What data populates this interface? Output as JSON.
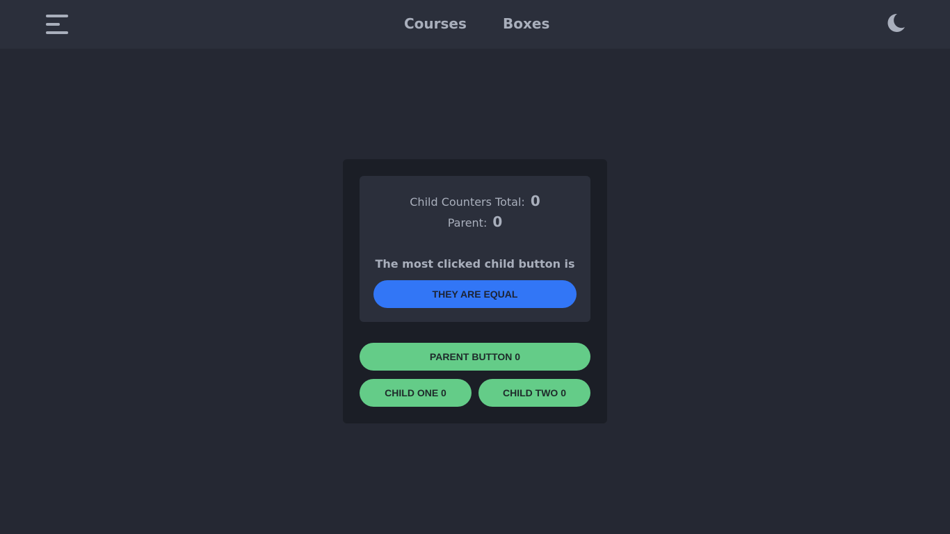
{
  "header": {
    "nav": [
      {
        "label": "Courses"
      },
      {
        "label": "Boxes"
      }
    ],
    "icons": {
      "menu": "hamburger-menu-icon",
      "theme": "moon-icon"
    }
  },
  "counter_card": {
    "child_total_label": "Child Counters Total:",
    "child_total_value": "0",
    "parent_label": "Parent:",
    "parent_value": "0",
    "most_clicked_label": "The most clicked child button is",
    "result_button": "THEY ARE EQUAL",
    "parent_button": "PARENT BUTTON 0",
    "child_one_button": "CHILD ONE 0",
    "child_two_button": "CHILD TWO 0"
  },
  "colors": {
    "background": "#252833",
    "topbar": "#2b2f3b",
    "card": "#1b1e26",
    "text": "#a9afbc",
    "accent_blue": "#3276f6",
    "accent_green": "#64cc88"
  }
}
